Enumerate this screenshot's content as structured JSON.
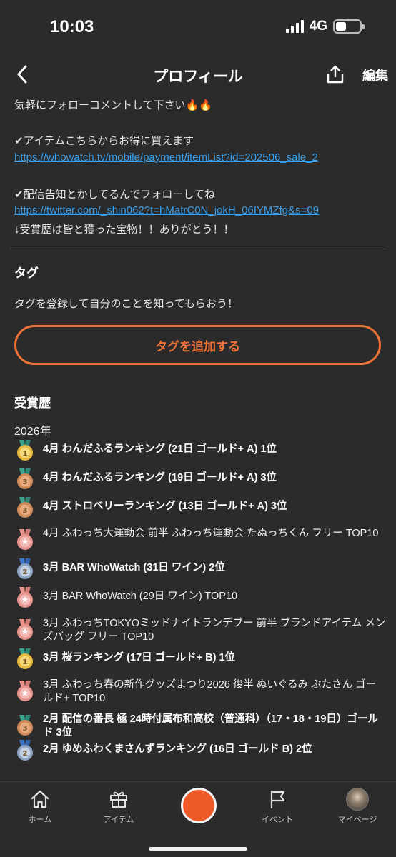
{
  "status_bar": {
    "time": "10:03",
    "network": "4G"
  },
  "nav": {
    "title": "プロフィール",
    "edit_label": "編集"
  },
  "bio": {
    "line1": "気軽にフォローコメントして下さい🔥🔥",
    "line2": "✔アイテムこちらからお得に買えます",
    "link1": "https://whowatch.tv/mobile/payment/itemList?id=202506_sale_2",
    "line3": "✔配信告知とかしてるんでフォローしてね",
    "link2": "https://twitter.com/_shin062?t=hMatrC0N_jokH_06IYMZfg&s=09",
    "line4": "↓受賞歴は皆と獲った宝物！！ありがとう！！"
  },
  "tags": {
    "title": "タグ",
    "hint": "タグを登録して自分のことを知ってもらおう！",
    "add_button": "タグを追加する"
  },
  "awards": {
    "title": "受賞歴",
    "year": "2026年",
    "items": [
      {
        "text": "4月 わんだふるランキング (21日 ゴールド+ A) 1位",
        "medal": "gold",
        "rank": "1",
        "bold": true
      },
      {
        "text": "4月 わんだふるランキング (19日 ゴールド+ A) 3位",
        "medal": "bronze",
        "rank": "3",
        "bold": true
      },
      {
        "text": "4月 ストロベリーランキング (13日 ゴールド+ A) 3位",
        "medal": "bronze",
        "rank": "3",
        "bold": true
      },
      {
        "text": "4月 ふわっち大運動会 前半 ふわっち運動会 たぬっちくん フリー TOP10",
        "medal": "pink",
        "rank": "",
        "bold": false
      },
      {
        "text": "3月 BAR WhoWatch (31日 ワイン) 2位",
        "medal": "silver",
        "rank": "2",
        "bold": true
      },
      {
        "text": "3月 BAR WhoWatch (29日 ワイン) TOP10",
        "medal": "pink",
        "rank": "",
        "bold": false
      },
      {
        "text": "3月 ふわっちTOKYOミッドナイトランデブー 前半 ブランドアイテム メンズバッグ フリー TOP10",
        "medal": "pink",
        "rank": "",
        "bold": false
      },
      {
        "text": "3月 桜ランキング (17日 ゴールド+ B) 1位",
        "medal": "gold",
        "rank": "1",
        "bold": true
      },
      {
        "text": "3月 ふわっち春の新作グッズまつり2026 後半 ぬいぐるみ ぶたさん ゴールド+ TOP10",
        "medal": "pink",
        "rank": "",
        "bold": false
      },
      {
        "text": "2月 配信の番長 極 24時付属布和高校（普通科）（17・18・19日）ゴールド 3位",
        "medal": "bronze",
        "rank": "3",
        "bold": true
      },
      {
        "text": "2月 ゆめふわくまさんずランキング (16日 ゴールド B) 2位",
        "medal": "silver",
        "rank": "2",
        "bold": true
      }
    ]
  },
  "tab_bar": {
    "home": "ホーム",
    "item": "アイテム",
    "event": "イベント",
    "mypage": "マイページ"
  },
  "colors": {
    "background": "#2b2b2b",
    "accent": "#ee7236",
    "link": "#3b9ee8",
    "record": "#ef5a2a"
  }
}
